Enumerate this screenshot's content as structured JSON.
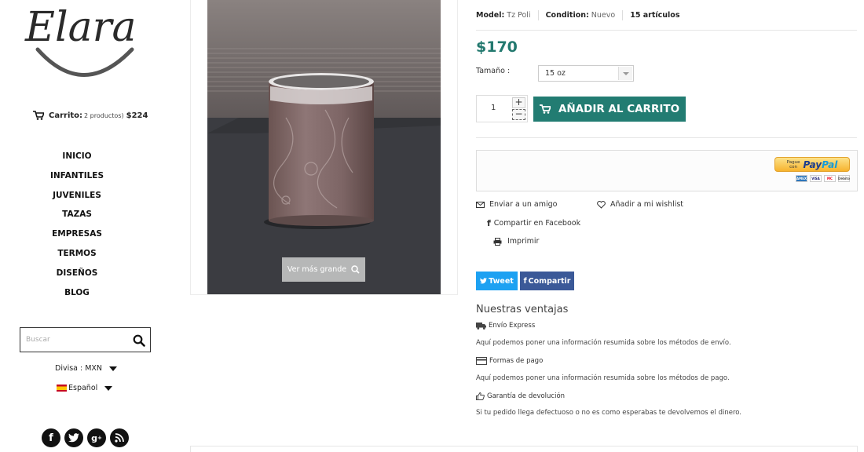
{
  "brand": {
    "logo_text": "Elara"
  },
  "cart": {
    "label": "Carrito:",
    "count": "2 productos)",
    "total": "$224"
  },
  "nav": {
    "items": [
      "INICIO",
      "INFANTILES",
      "JUVENILES",
      "TAZAS",
      "EMPRESAS",
      "TERMOS",
      "DISEÑOS",
      "BLOG"
    ]
  },
  "search": {
    "placeholder": "Buscar"
  },
  "currency": {
    "label": "Divisa : MXN"
  },
  "language": {
    "label": "Español"
  },
  "social": {
    "icons": [
      "facebook-icon",
      "twitter-icon",
      "google-plus-icon",
      "rss-icon"
    ]
  },
  "image": {
    "zoom_label": "Ver más grande"
  },
  "product": {
    "model_label": "Model:",
    "model_value": "Tz Poli",
    "condition_label": "Condition:",
    "condition_value": "Nuevo",
    "stock": "15 artículos",
    "price": "$170",
    "size_label": "Tamaño :",
    "size_value": "15 oz",
    "quantity": "1",
    "add_to_cart": "AÑADIR AL CARRITO"
  },
  "paypal": {
    "pague": "Pague",
    "con": "con",
    "brand_pay": "Pay",
    "brand_pal": "Pal",
    "cards": [
      "AMEX",
      "VISA",
      "MC",
      "Débito"
    ]
  },
  "actions": {
    "send_friend": "Enviar a un amigo",
    "wishlist": "Añadir a mi wishlist",
    "facebook_share": "Compartir en Facebook",
    "print": "Imprimir"
  },
  "share": {
    "tweet": "Tweet",
    "compartir": "Compartir"
  },
  "advantages": {
    "title": "Nuestras ventajas",
    "items": [
      {
        "heading": "Envío Express",
        "text": "Aquí podemos poner una información resumida sobre los métodos de envío."
      },
      {
        "heading": "Formas de pago",
        "text": "Aquí podemos poner una información resumida sobre los métodos de pago."
      },
      {
        "heading": "Garantía de devolución",
        "text": "Si tu pedido llega defectuoso o no es como esperabas te devolvemos el dinero."
      }
    ]
  },
  "colors": {
    "accent": "#227c72",
    "price": "#23796f",
    "tweet": "#1da1f2",
    "facebook": "#3b5998"
  }
}
